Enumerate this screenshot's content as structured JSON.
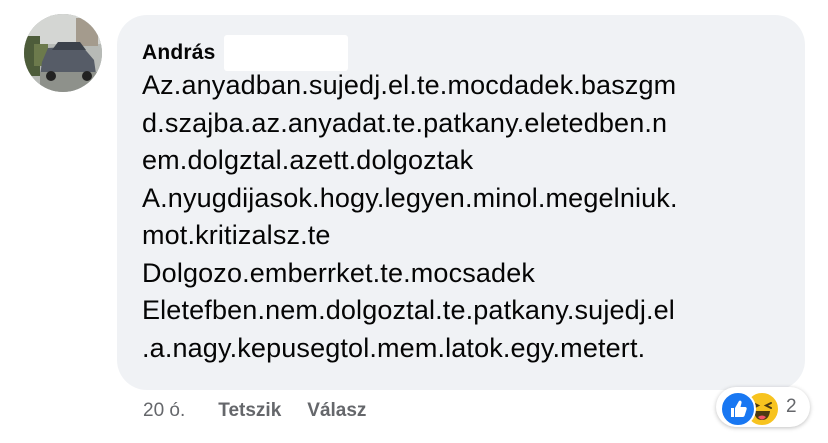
{
  "comment": {
    "author": "András",
    "lines": [
      "Az.anyadban.sujedj.el.te.mocdadek.baszgm",
      "d.szajba.az.anyadat.te.patkany.eletedben.n",
      "em.dolgztal.azett.dolgoztak",
      "A.nyugdijasok.hogy.legyen.minol.megelniuk.",
      "mot.kritizalsz.te",
      "Dolgozo.emberrket.te.mocsadek",
      "Eletefben.nem.dolgoztal.te.patkany.sujedj.el",
      ".a.nagy.kepusegtol.mem.latok.egy.metert."
    ]
  },
  "actions": {
    "timestamp": "20 ó.",
    "like_label": "Tetszik",
    "reply_label": "Válasz"
  },
  "reactions": {
    "icons": [
      "like-icon",
      "haha-icon"
    ],
    "count": "2"
  },
  "colors": {
    "bubble": "#f0f2f5",
    "text": "#050505",
    "secondary": "#65676b",
    "like": "#1877f2",
    "haha": "#f7c31f"
  }
}
